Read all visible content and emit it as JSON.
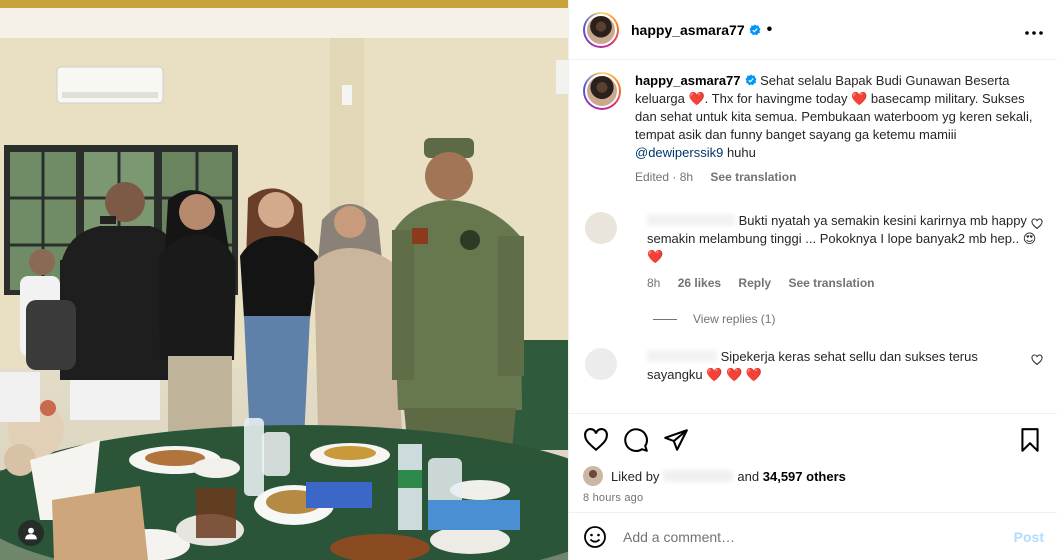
{
  "post": {
    "username": "happy_asmara77",
    "verified": true,
    "separator": "•",
    "more_label": "•••"
  },
  "caption": {
    "username": "happy_asmara77",
    "text_1": "Sehat selalu Bapak Budi Gunawan Beserta keluarga ",
    "heart_1": "❤️",
    "text_2": ". Thx for havingme today ",
    "heart_2": "❤️",
    "text_3": " basecamp military. Sukses dan sehat untuk kita semua. Pembukaan waterboom yg keren sekali, tempat asik dan funny banget sayang ga ketemu mamiii ",
    "mention": "@dewiperssik9",
    "text_4": " huhu",
    "edited": "Edited · 8h",
    "see_translation": "See translation"
  },
  "comments": [
    {
      "text": "Bukti nyatah ya semakin kesini karirnya mb happy semakin melambung tinggi ... Pokoknya I lope banyak2 mb hep.. ",
      "emoji": "😍❤️",
      "time": "8h",
      "likes": "26 likes",
      "reply": "Reply",
      "see_translation": "See translation",
      "view_replies": "View replies (1)"
    },
    {
      "text": "Sipekerja keras sehat sellu dan sukses terus sayangku",
      "emoji": "❤️ ❤️ ❤️"
    }
  ],
  "likes": {
    "prefix": "Liked by",
    "suffix": "and",
    "count": "34,597 others",
    "ago": "8 hours ago"
  },
  "add_comment": {
    "placeholder": "Add a comment…",
    "post_label": "Post"
  },
  "colors": {
    "verified_blue": "#0095f6",
    "heart_red": "#ed1a3b",
    "link_blue": "#00376b",
    "post_disabled": "#b3dbff"
  },
  "icons": [
    "user-tag-icon",
    "verified-icon",
    "more-icon",
    "heart-icon",
    "comment-icon",
    "share-icon",
    "bookmark-icon",
    "emoji-icon"
  ]
}
